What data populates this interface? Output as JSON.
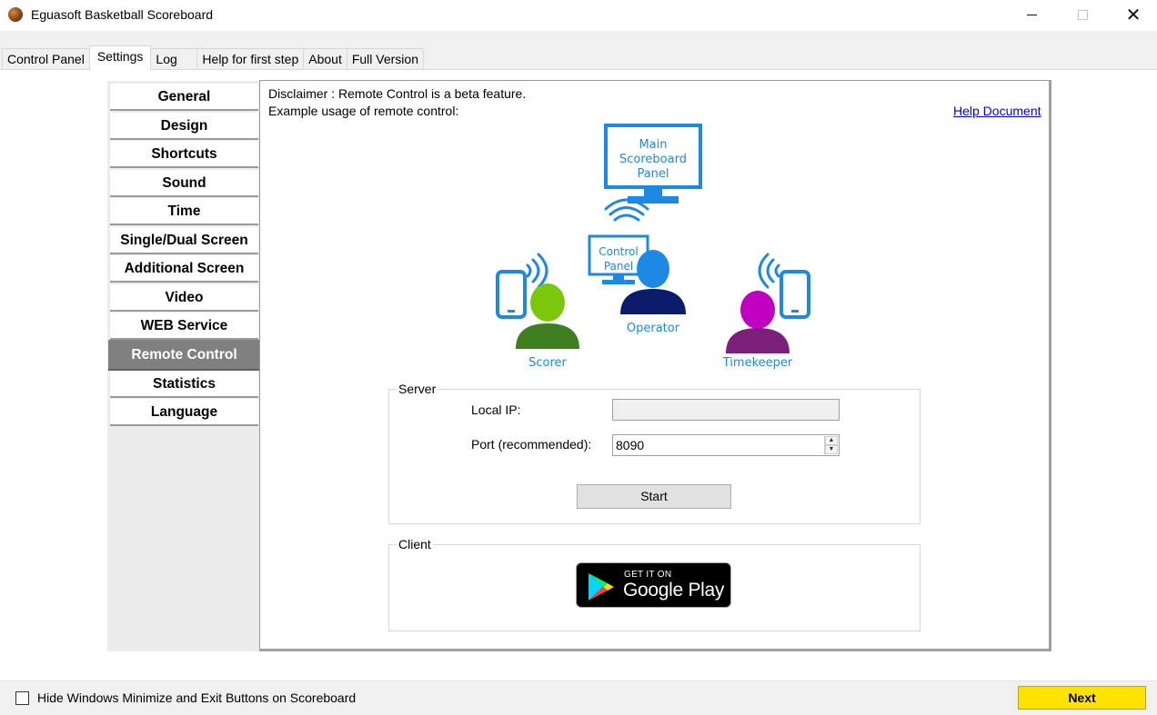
{
  "window": {
    "title": "Eguasoft Basketball Scoreboard",
    "minimize_glyph": "",
    "maximize_glyph": "",
    "close_glyph": "✕"
  },
  "tabs": [
    {
      "label": "Control Panel",
      "active": false
    },
    {
      "label": "Settings",
      "active": true
    },
    {
      "label": "Log",
      "active": false
    },
    {
      "label": "Help for first step",
      "active": false
    },
    {
      "label": "About",
      "active": false
    },
    {
      "label": "Full Version",
      "active": false
    }
  ],
  "sidebar": {
    "items": [
      {
        "label": "General",
        "selected": false
      },
      {
        "label": "Design",
        "selected": false
      },
      {
        "label": "Shortcuts",
        "selected": false
      },
      {
        "label": "Sound",
        "selected": false
      },
      {
        "label": "Time",
        "selected": false
      },
      {
        "label": "Single/Dual Screen",
        "selected": false
      },
      {
        "label": "Additional Screen",
        "selected": false
      },
      {
        "label": "Video",
        "selected": false
      },
      {
        "label": "WEB Service",
        "selected": false
      },
      {
        "label": "Remote Control",
        "selected": true
      },
      {
        "label": "Statistics",
        "selected": false
      },
      {
        "label": "Language",
        "selected": false
      }
    ]
  },
  "main": {
    "disclaimer": "Disclaimer : Remote Control is a beta feature.",
    "example": "Example usage of remote control:",
    "help_link": "Help Document",
    "diagram": {
      "main_panel": [
        "Main",
        "Scoreboard",
        "Panel"
      ],
      "control_panel": [
        "Control",
        "Panel"
      ],
      "operator": "Operator",
      "scorer": "Scorer",
      "timekeeper": "Timekeeper",
      "colors": {
        "blue": "#1e88e5",
        "operator_head": "#1e88e5",
        "operator_body": "#0d1b6b",
        "scorer_head": "#7ac70c",
        "scorer_body": "#3f7f1f",
        "timekeeper_head": "#c000c0",
        "timekeeper_body": "#7b1f7b"
      }
    },
    "server": {
      "legend": "Server",
      "local_ip_label": "Local IP:",
      "local_ip_value": "",
      "port_label": "Port (recommended):",
      "port_value": "8090",
      "start_label": "Start"
    },
    "client": {
      "legend": "Client",
      "badge_small": "GET IT ON",
      "badge_big": "Google Play"
    }
  },
  "footer": {
    "checkbox_label": "Hide Windows Minimize and Exit Buttons on Scoreboard",
    "checked": false,
    "next_label": "Next",
    "next_color": "#ffe200"
  }
}
